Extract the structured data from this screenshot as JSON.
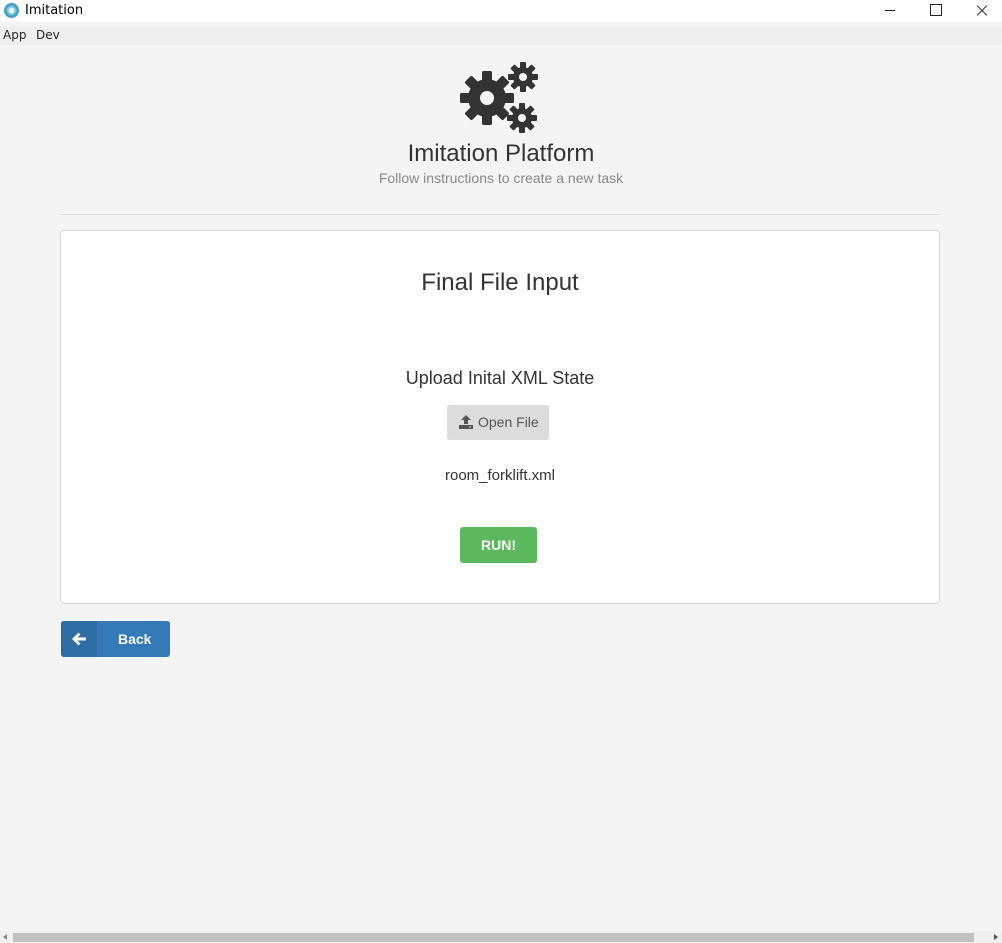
{
  "window": {
    "title": "Imitation",
    "app_icon": "imitation-app-icon",
    "controls": [
      "minimize-icon",
      "maximize-icon",
      "close-icon"
    ]
  },
  "menu": {
    "items": [
      {
        "label": "App"
      },
      {
        "label": "Dev"
      }
    ]
  },
  "header": {
    "icon": "gears-icon",
    "title": "Imitation Platform",
    "subtitle": "Follow instructions to create a new task"
  },
  "card": {
    "title": "Final File Input",
    "upload_label": "Upload Inital XML State",
    "open_file": {
      "label": "Open File",
      "icon": "upload-icon"
    },
    "filename": "room_forklift.xml",
    "run_label": "RUN!"
  },
  "back": {
    "label": "Back",
    "icon": "arrow-left-icon"
  },
  "colors": {
    "background": "#f4f4f4",
    "run_green": "#5cb85c",
    "back_blue": "#337ab7",
    "open_file_gray": "#dcdcdc",
    "text": "#333333",
    "subtitle": "#888888"
  }
}
